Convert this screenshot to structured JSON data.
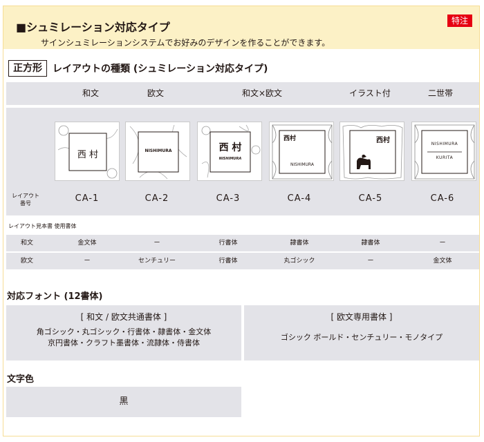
{
  "header": {
    "title": "■シュミレーション対応タイプ",
    "subtitle": "サインシュミレーションシステムでお好みのデザインを作ることができます。",
    "badge": "特注"
  },
  "section": {
    "box_label": "正方形",
    "heading": "レイアウトの種類 (シュミレーション対応タイプ)"
  },
  "columns": [
    "和文",
    "欧文",
    "和文×欧文",
    "イラスト付",
    "二世帯"
  ],
  "layout_label_line1": "レイアウト",
  "layout_label_line2": "番号",
  "layouts": [
    {
      "code": "CA-1",
      "jp": "西 村",
      "en": ""
    },
    {
      "code": "CA-2",
      "jp": "",
      "en": "NISHIMURA"
    },
    {
      "code": "CA-3",
      "jp": "西 村",
      "en": "NISHIMURA"
    },
    {
      "code": "CA-4",
      "jp": "西村",
      "en": "NISHIMURA"
    },
    {
      "code": "CA-5",
      "jp": "西村",
      "en": ""
    },
    {
      "code": "CA-6",
      "jp": "",
      "en": "NISHIMURA",
      "en2": "KURITA"
    }
  ],
  "sample_note": "レイアウト見本書 使用書体",
  "font_rows": [
    {
      "label": "和文",
      "values": [
        "金文体",
        "ー",
        "行書体",
        "隷書体",
        "隷書体",
        "ー"
      ]
    },
    {
      "label": "欧文",
      "values": [
        "ー",
        "センチュリー",
        "行書体",
        "丸ゴシック",
        "ー",
        "金文体"
      ]
    }
  ],
  "fonts_heading": "対応フォント (12書体)",
  "common_fonts": {
    "heading": "[ 和文 / 欧文共通書体 ]",
    "line1": "角ゴシック・丸ゴシック・行書体・隷書体・金文体",
    "line2": "京円書体・クラフト墨書体・流隷体・侍書体"
  },
  "western_fonts": {
    "heading": "[ 欧文専用書体 ]",
    "line1": "ゴシック ボールド・センチュリー・モノタイプ"
  },
  "color_heading": "文字色",
  "color_value": "黒"
}
